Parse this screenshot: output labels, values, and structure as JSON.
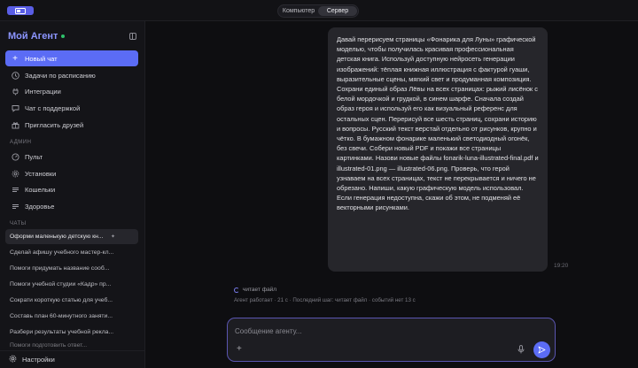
{
  "topbar": {
    "segments": [
      {
        "label": "Компьютер",
        "active": false
      },
      {
        "label": "Сервер",
        "active": true
      }
    ]
  },
  "sidebar": {
    "brand": "Мой Агент",
    "nav": [
      {
        "label": "Новый чат",
        "icon": "plus-icon"
      },
      {
        "label": "Задачи по расписанию",
        "icon": "clock-icon"
      },
      {
        "label": "Интеграции",
        "icon": "plug-icon"
      },
      {
        "label": "Чат с поддержкой",
        "icon": "chat-icon"
      },
      {
        "label": "Пригласить друзей",
        "icon": "gift-icon"
      }
    ],
    "admin_label": "АДМИН",
    "admin": [
      {
        "label": "Пульт",
        "icon": "dashboard-icon"
      },
      {
        "label": "Установки",
        "icon": "gear-icon"
      },
      {
        "label": "Кошельки",
        "icon": "wallet-icon"
      },
      {
        "label": "Здоровье",
        "icon": "pulse-icon"
      }
    ],
    "chats_label": "ЧАТЫ",
    "chats": [
      "Оформи маленькую детскую кн...",
      "Сделай афишу учебного мастер-кл...",
      "Помоги придумать название сооб...",
      "Помоги учебной студии «Кадр» пр...",
      "Сократи короткую статью для учеб...",
      "Составь план 60-минутного заняти...",
      "Разбери результаты учебной рекла...",
      "Помоги подготовить ответ..."
    ],
    "settings": "Настройки"
  },
  "main": {
    "message": "Давай перерисуем страницы «Фонарика для Луны» графической моделью, чтобы получилась красивая профессиональная детская книга. Используй доступную нейросеть генерации изображений: тёплая книжная иллюстрация с фактурой гуаши, выразительные сцены, мягкий свет и продуманная композиция. Сохрани единый образ Лёвы на всех страницах: рыжий лисёнок с белой мордочкой и грудкой, в синем шарфе. Сначала создай образ героя и используй его как визуальный референс для остальных сцен. Перерисуй все шесть страниц, сохрани историю и вопросы. Русский текст верстай отдельно от рисунков, крупно и чётко. В бумажном фонарике маленький светодиодный огонёк, без свечи. Собери новый PDF и покажи все страницы картинками. Назови новые файлы fonarik-luna-illustrated-final.pdf и illustrated-01.png — illustrated-06.png. Проверь, что герой узнаваем на всех страницах, текст не перекрывается и ничего не обрезано. Напиши, какую графическую модель использовал. Если генерация недоступна, скажи об этом, не подменяй её векторными рисунками.",
    "time": "19:20",
    "status": "читает файл",
    "meta": "Агент работает · 21 с · Последний шаг: читает файл · событий нет 13 с",
    "composer_placeholder": "Сообщение агенту..."
  },
  "colors": {
    "accent": "#5b6cf5",
    "brand": "#8c95ff",
    "online": "#2ec26b"
  }
}
